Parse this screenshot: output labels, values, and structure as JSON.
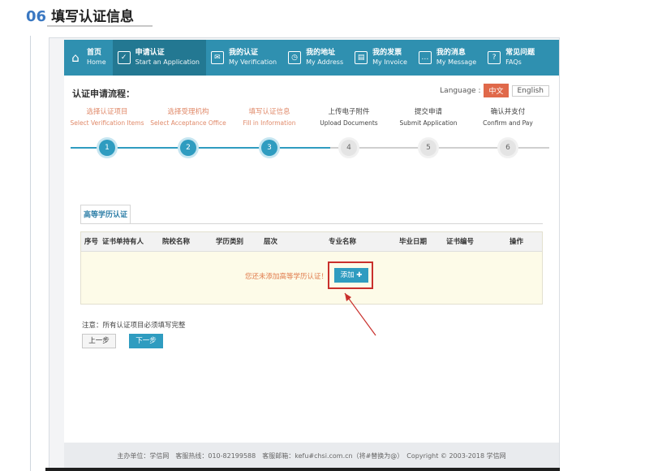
{
  "heading": {
    "number": "06",
    "title": "填写认证信息"
  },
  "nav": {
    "items": [
      {
        "zh": "首页",
        "en": "Home",
        "icon": "home-icon"
      },
      {
        "zh": "申请认证",
        "en": "Start an Application",
        "icon": "checkbox-icon",
        "active": true
      },
      {
        "zh": "我的认证",
        "en": "My Verification",
        "icon": "mail-icon"
      },
      {
        "zh": "我的地址",
        "en": "My Address",
        "icon": "clock-icon"
      },
      {
        "zh": "我的发票",
        "en": "My Invoice",
        "icon": "invoice-icon"
      },
      {
        "zh": "我的消息",
        "en": "My Message",
        "icon": "message-icon"
      },
      {
        "zh": "常见问题",
        "en": "FAQs",
        "icon": "question-icon"
      }
    ]
  },
  "process": {
    "title": "认证申请流程："
  },
  "language": {
    "label": "Language :",
    "zh": "中文",
    "en": "English"
  },
  "steps": [
    {
      "zh": "选择认证项目",
      "en": "Select Verification Items",
      "num": "1",
      "done": true
    },
    {
      "zh": "选择受理机构",
      "en": "Select Acceptance Office",
      "num": "2",
      "done": true
    },
    {
      "zh": "填写认证信息",
      "en": "Fill in Information",
      "num": "3",
      "done": true
    },
    {
      "zh": "上传电子附件",
      "en": "Upload Documents",
      "num": "4",
      "done": false
    },
    {
      "zh": "提交申请",
      "en": "Submit Application",
      "num": "5",
      "done": false
    },
    {
      "zh": "确认并支付",
      "en": "Confirm and Pay",
      "num": "6",
      "done": false
    }
  ],
  "tab": {
    "label": "高等学历认证"
  },
  "table": {
    "headers": [
      "序号",
      "证书单持有人",
      "院校名称",
      "学历类别",
      "层次",
      "专业名称",
      "毕业日期",
      "证书编号",
      "操作"
    ],
    "empty_message": "您还未添加高等学历认证！",
    "add_label": "添加"
  },
  "note": "注意：所有认证项目必须填写完整",
  "buttons": {
    "prev": "上一步",
    "next": "下一步"
  },
  "footer": "主办单位：学信网　客服热线：010-82199588　客服邮箱：kefu#chsi.com.cn（将#替换为@）　Copyright © 2003-2018 学信网",
  "colors": {
    "nav": "#2f90b0",
    "nav_active": "#237892",
    "accent": "#2f9cc0",
    "step_done_text": "#e08a6a",
    "highlight": "#c9302c"
  }
}
